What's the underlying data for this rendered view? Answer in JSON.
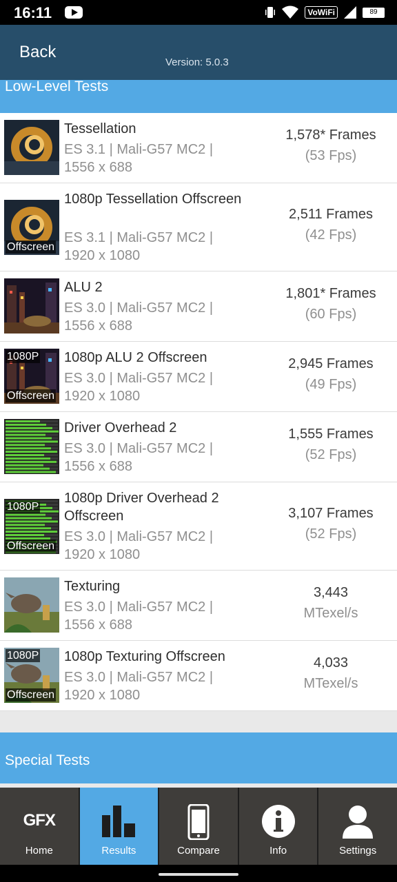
{
  "status_bar": {
    "time": "16:11",
    "vowifi": "VoWiFi",
    "battery": "89"
  },
  "app_bar": {
    "back_label": "Back",
    "version": "Version: 5.0.3"
  },
  "sections": {
    "low_level": "Low-Level Tests",
    "special": "Special Tests"
  },
  "tests": [
    {
      "name": "Tessellation",
      "meta": "ES 3.1 | Mali-G57 MC2 | 1556 x 688",
      "score": "1,578* Frames",
      "sub": "(53 Fps)",
      "tag_top": "",
      "tag_bottom": ""
    },
    {
      "name": "1080p Tessellation Offscreen",
      "meta": "ES 3.1 | Mali-G57 MC2 | 1920 x 1080",
      "score": "2,511 Frames",
      "sub": "(42 Fps)",
      "tag_top": "",
      "tag_bottom": "Offscreen"
    },
    {
      "name": "ALU 2",
      "meta": "ES 3.0 | Mali-G57 MC2 | 1556 x 688",
      "score": "1,801* Frames",
      "sub": "(60 Fps)",
      "tag_top": "",
      "tag_bottom": ""
    },
    {
      "name": "1080p ALU 2 Offscreen",
      "meta": "ES 3.0 | Mali-G57 MC2 | 1920 x 1080",
      "score": "2,945 Frames",
      "sub": "(49 Fps)",
      "tag_top": "1080P",
      "tag_bottom": "Offscreen"
    },
    {
      "name": "Driver Overhead 2",
      "meta": "ES 3.0 | Mali-G57 MC2 | 1556 x 688",
      "score": "1,555 Frames",
      "sub": "(52 Fps)",
      "tag_top": "",
      "tag_bottom": ""
    },
    {
      "name": "1080p Driver Overhead 2 Offscreen",
      "meta": "ES 3.0 | Mali-G57 MC2 | 1920 x 1080",
      "score": "3,107 Frames",
      "sub": "(52 Fps)",
      "tag_top": "1080P",
      "tag_bottom": "Offscreen"
    },
    {
      "name": "Texturing",
      "meta": "ES 3.0 | Mali-G57 MC2 | 1556 x 688",
      "score": "3,443",
      "sub": "MTexel/s",
      "tag_top": "",
      "tag_bottom": ""
    },
    {
      "name": "1080p Texturing Offscreen",
      "meta": "ES 3.0 | Mali-G57 MC2 | 1920 x 1080",
      "score": "4,033",
      "sub": "MTexel/s",
      "tag_top": "1080P",
      "tag_bottom": "Offscreen"
    }
  ],
  "nav": {
    "home_logo": "GFX",
    "home": "Home",
    "results": "Results",
    "compare": "Compare",
    "info": "Info",
    "settings": "Settings"
  },
  "icons": {
    "thumb_kind": [
      "torus",
      "torus",
      "city",
      "city",
      "bars",
      "bars",
      "dino",
      "dino"
    ]
  }
}
